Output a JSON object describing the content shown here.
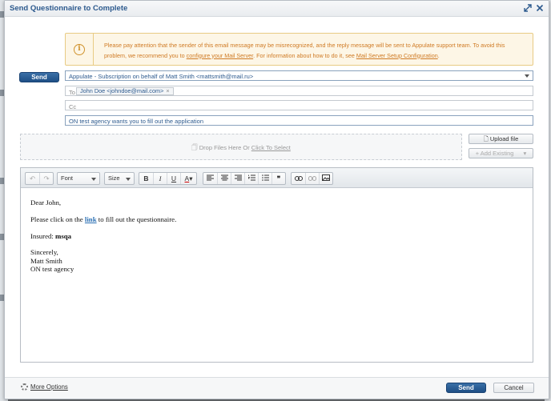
{
  "dialog": {
    "title": "Send Questionnaire to Complete"
  },
  "warning": {
    "text_before": "Please pay attention that the sender of this email message may be misrecognized, and the reply message will be sent to Appulate support team. To avoid this problem, we recommend you to ",
    "link_configure": "configure your Mail Server",
    "text_middle": ". For information about how to do it, see ",
    "link_setup": "Mail Server Setup Configuration",
    "text_after": "."
  },
  "compose": {
    "send_label": "Send",
    "from_value": "Appulate - Subscription on behalf of Matt Smith <mattsmith@mail.ru>",
    "to_label": "To",
    "to_recipient": "John Doe <johndoe@mail.com>",
    "cc_placeholder": "Cc",
    "subject_value": "ON test agency wants you to fill out the application"
  },
  "attachments": {
    "drop_text": "Drop Files Here Or ",
    "drop_link": "Click To Select",
    "upload_label": "Upload file",
    "add_existing_label": "+ Add Existing"
  },
  "toolbar": {
    "font_label": "Font",
    "size_label": "Size"
  },
  "message": {
    "greeting": "Dear John,",
    "line1_before": "Please click on the ",
    "line1_link": "link",
    "line1_after": " to fill out the questionnaire.",
    "insured_label": "Insured: ",
    "insured_value": "msqa",
    "closing": "Sincerely,",
    "sender_name": "Matt Smith",
    "sender_agency": "ON test agency"
  },
  "footer": {
    "more_options_label": "More Options",
    "send_label": "Send",
    "cancel_label": "Cancel"
  }
}
